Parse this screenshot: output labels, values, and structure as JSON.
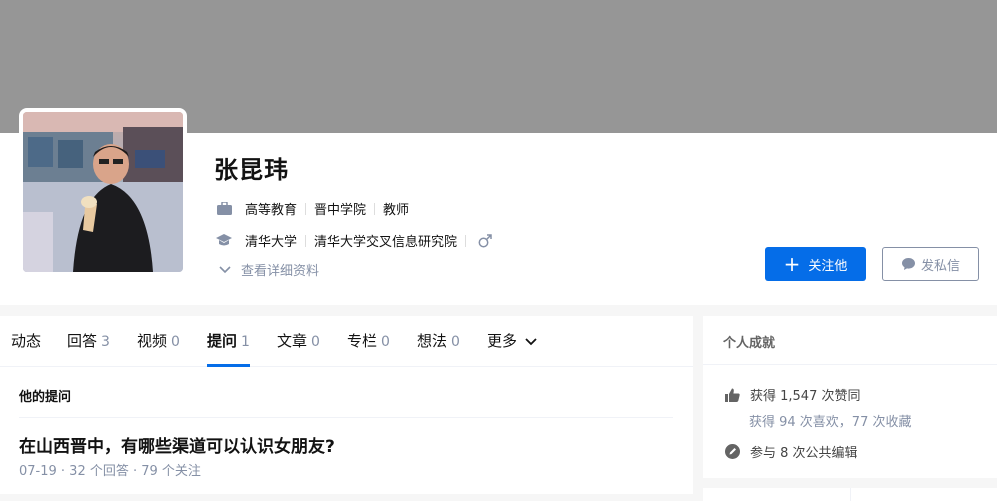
{
  "user": {
    "name": "张昆玮",
    "industry": "高等教育",
    "company": "晋中学院",
    "job": "教师",
    "school": "清华大学",
    "major": "清华大学交叉信息研究院",
    "gender_icon": "male-icon",
    "detail_link": "查看详细资料"
  },
  "actions": {
    "follow_label": "关注他",
    "message_label": "发私信"
  },
  "tabs": [
    {
      "label": "动态",
      "count": ""
    },
    {
      "label": "回答",
      "count": "3"
    },
    {
      "label": "视频",
      "count": "0"
    },
    {
      "label": "提问",
      "count": "1"
    },
    {
      "label": "文章",
      "count": "0"
    },
    {
      "label": "专栏",
      "count": "0"
    },
    {
      "label": "想法",
      "count": "0"
    },
    {
      "label": "更多",
      "count": ""
    }
  ],
  "questions": {
    "section_title": "他的提问",
    "items": [
      {
        "title": "在山西晋中，有哪些渠道可以认识女朋友?",
        "meta": "07-19 · 32 个回答 · 79 个关注"
      }
    ]
  },
  "achievements": {
    "title": "个人成就",
    "likes": "获得 1,547 次赞同",
    "likes_sub": "获得 94 次喜欢，77 次收藏",
    "edits": "参与 8 次公共编辑"
  },
  "colors": {
    "accent": "#056de8",
    "muted": "#8590a6",
    "cover": "#969696"
  }
}
